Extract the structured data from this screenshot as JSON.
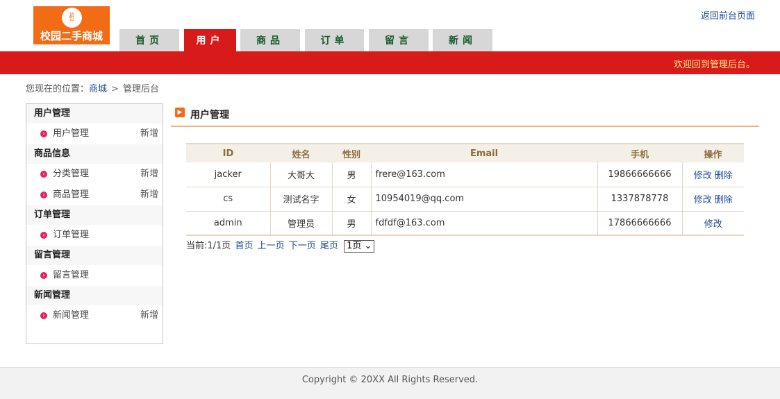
{
  "logo": {
    "glyph": "✌",
    "text": "校园二手商城"
  },
  "header": {
    "back_link": "返回前台页面"
  },
  "nav": {
    "tabs": [
      "首页",
      "用户",
      "商品",
      "订单",
      "留言",
      "新闻"
    ],
    "active_index": 1
  },
  "banner": {
    "welcome": "欢迎回到管理后台。"
  },
  "breadcrumb": {
    "prefix": "您现在的位置：",
    "link": "商城",
    "sep": ">",
    "current": "管理后台"
  },
  "sidebar": {
    "groups": [
      {
        "title": "用户管理",
        "items": [
          {
            "label": "用户管理",
            "add": "新增"
          }
        ]
      },
      {
        "title": "商品信息",
        "items": [
          {
            "label": "分类管理",
            "add": "新增"
          },
          {
            "label": "商品管理",
            "add": "新增"
          }
        ]
      },
      {
        "title": "订单管理",
        "items": [
          {
            "label": "订单管理",
            "add": ""
          }
        ]
      },
      {
        "title": "留言管理",
        "items": [
          {
            "label": "留言管理",
            "add": ""
          }
        ]
      },
      {
        "title": "新闻管理",
        "items": [
          {
            "label": "新闻管理",
            "add": "新增"
          }
        ]
      }
    ]
  },
  "main": {
    "title": "用户管理",
    "table": {
      "headers": [
        "ID",
        "姓名",
        "性别",
        "Email",
        "手机",
        "操作"
      ],
      "rows": [
        {
          "id": "jacker",
          "name": "大哥大",
          "gender": "男",
          "email": "frere@163.com",
          "phone": "19866666666",
          "ops": [
            "修改",
            "删除"
          ]
        },
        {
          "id": "cs",
          "name": "测试名字",
          "gender": "女",
          "email": "10954019@qq.com",
          "phone": "1337878778",
          "ops": [
            "修改",
            "删除"
          ]
        },
        {
          "id": "admin",
          "name": "管理员",
          "gender": "男",
          "email": "fdfdf@163.com",
          "phone": "17866666666",
          "ops": [
            "修改"
          ]
        }
      ]
    },
    "pager": {
      "status": "当前:1/1页",
      "first": "首页",
      "prev": "上一页",
      "next": "下一页",
      "last": "尾页",
      "select_value": "1页 ⌄"
    }
  },
  "footer": {
    "copyright": "Copyright © 20XX All Rights Reserved."
  }
}
